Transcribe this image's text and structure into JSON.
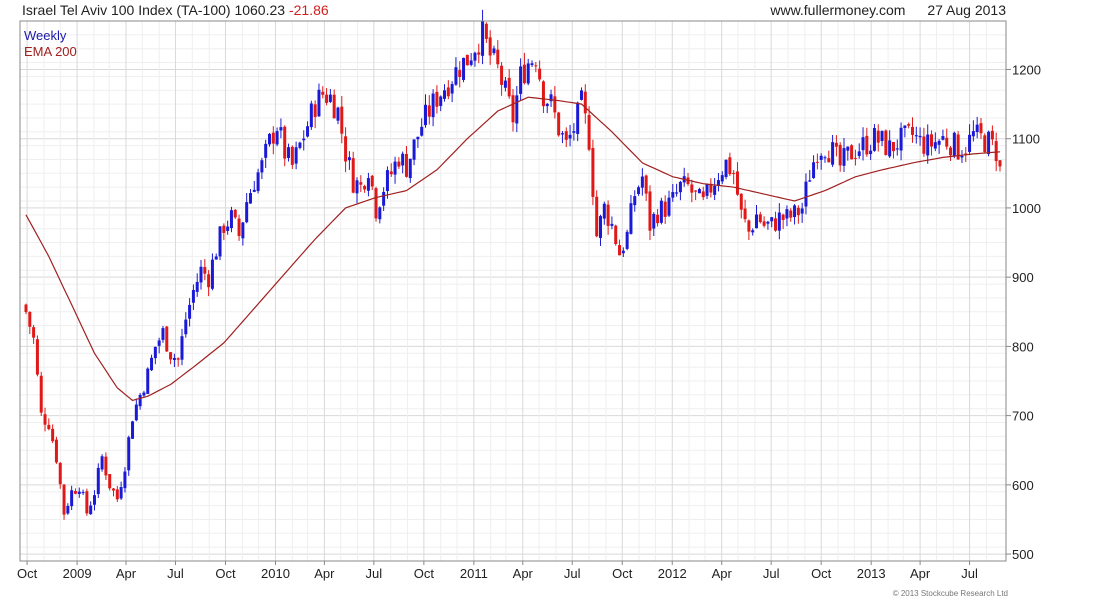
{
  "header": {
    "index_name": "Israel Tel Aviv 100 Index (TA-100)",
    "last_value": "1060.23",
    "change": "-21.86",
    "site": "www.fullermoney.com",
    "date": "27 Aug 2013"
  },
  "legend": {
    "series1": "Weekly",
    "series2": "EMA 200"
  },
  "copyright": "© 2013 Stockcube Research Ltd",
  "colors": {
    "up": "#1a1ad6",
    "down": "#e01818",
    "ema": "#a02020",
    "grid": "#d9d9d9"
  },
  "chart_data": {
    "type": "line",
    "subtype": "candlestick",
    "title": "Israel Tel Aviv 100 Index (TA-100) 1060.23 -21.86",
    "xlabel": "",
    "ylabel": "",
    "ylim": [
      490,
      1270
    ],
    "yticks": [
      500,
      600,
      700,
      800,
      900,
      1000,
      1100,
      1200
    ],
    "xticks": [
      "Oct",
      "2009",
      "Apr",
      "Jul",
      "Oct",
      "2010",
      "Apr",
      "Jul",
      "Oct",
      "2011",
      "Apr",
      "Jul",
      "Oct",
      "2012",
      "Apr",
      "Jul",
      "Oct",
      "2013",
      "Apr",
      "Jul"
    ],
    "grid": true,
    "axis_side": "right",
    "x_start": "2008-09-29",
    "x_end": "2013-08-26",
    "weekly_anchor_prices": [
      [
        "2008-09-29",
        850
      ],
      [
        "2008-10-13",
        810
      ],
      [
        "2008-10-27",
        700
      ],
      [
        "2008-11-10",
        690
      ],
      [
        "2008-11-24",
        640
      ],
      [
        "2008-12-08",
        560
      ],
      [
        "2008-12-22",
        590
      ],
      [
        "2009-01-05",
        600
      ],
      [
        "2009-01-19",
        560
      ],
      [
        "2009-02-02",
        590
      ],
      [
        "2009-02-16",
        640
      ],
      [
        "2009-03-02",
        600
      ],
      [
        "2009-03-16",
        580
      ],
      [
        "2009-03-30",
        630
      ],
      [
        "2009-04-13",
        700
      ],
      [
        "2009-04-27",
        730
      ],
      [
        "2009-05-11",
        760
      ],
      [
        "2009-05-25",
        800
      ],
      [
        "2009-06-08",
        820
      ],
      [
        "2009-06-22",
        790
      ],
      [
        "2009-07-06",
        780
      ],
      [
        "2009-07-20",
        840
      ],
      [
        "2009-08-03",
        880
      ],
      [
        "2009-08-17",
        910
      ],
      [
        "2009-08-31",
        900
      ],
      [
        "2009-09-14",
        940
      ],
      [
        "2009-09-28",
        975
      ],
      [
        "2009-10-12",
        985
      ],
      [
        "2009-10-26",
        960
      ],
      [
        "2009-11-09",
        1010
      ],
      [
        "2009-11-23",
        1040
      ],
      [
        "2009-12-07",
        1060
      ],
      [
        "2009-12-21",
        1095
      ],
      [
        "2010-01-04",
        1120
      ],
      [
        "2010-01-18",
        1080
      ],
      [
        "2010-02-01",
        1060
      ],
      [
        "2010-02-15",
        1090
      ],
      [
        "2010-03-01",
        1120
      ],
      [
        "2010-03-15",
        1150
      ],
      [
        "2010-03-29",
        1165
      ],
      [
        "2010-04-12",
        1160
      ],
      [
        "2010-04-26",
        1140
      ],
      [
        "2010-05-10",
        1080
      ],
      [
        "2010-05-24",
        1040
      ],
      [
        "2010-06-07",
        1030
      ],
      [
        "2010-06-21",
        1060
      ],
      [
        "2010-07-05",
        1000
      ],
      [
        "2010-07-19",
        1030
      ],
      [
        "2010-08-02",
        1050
      ],
      [
        "2010-08-16",
        1075
      ],
      [
        "2010-08-30",
        1060
      ],
      [
        "2010-09-13",
        1090
      ],
      [
        "2010-09-27",
        1120
      ],
      [
        "2010-10-11",
        1140
      ],
      [
        "2010-10-25",
        1160
      ],
      [
        "2010-11-08",
        1175
      ],
      [
        "2010-11-22",
        1190
      ],
      [
        "2010-12-06",
        1205
      ],
      [
        "2010-12-20",
        1215
      ],
      [
        "2011-01-03",
        1235
      ],
      [
        "2011-01-17",
        1250
      ],
      [
        "2011-01-31",
        1220
      ],
      [
        "2011-02-14",
        1200
      ],
      [
        "2011-02-28",
        1165
      ],
      [
        "2011-03-14",
        1130
      ],
      [
        "2011-03-28",
        1190
      ],
      [
        "2011-04-11",
        1210
      ],
      [
        "2011-04-25",
        1220
      ],
      [
        "2011-05-09",
        1165
      ],
      [
        "2011-05-23",
        1150
      ],
      [
        "2011-06-06",
        1115
      ],
      [
        "2011-06-20",
        1090
      ],
      [
        "2011-07-04",
        1115
      ],
      [
        "2011-07-18",
        1150
      ],
      [
        "2011-08-01",
        1100
      ],
      [
        "2011-08-15",
        960
      ],
      [
        "2011-08-29",
        1000
      ],
      [
        "2011-09-12",
        975
      ],
      [
        "2011-09-26",
        935
      ],
      [
        "2011-10-10",
        960
      ],
      [
        "2011-10-24",
        1020
      ],
      [
        "2011-11-07",
        1045
      ],
      [
        "2011-11-21",
        975
      ],
      [
        "2011-12-05",
        995
      ],
      [
        "2011-12-19",
        1000
      ],
      [
        "2012-01-02",
        1010
      ],
      [
        "2012-01-16",
        1030
      ],
      [
        "2012-01-30",
        1030
      ],
      [
        "2012-02-13",
        1015
      ],
      [
        "2012-02-27",
        1005
      ],
      [
        "2012-03-12",
        1030
      ],
      [
        "2012-03-26",
        1050
      ],
      [
        "2012-04-09",
        1065
      ],
      [
        "2012-04-23",
        1050
      ],
      [
        "2012-05-07",
        990
      ],
      [
        "2012-05-21",
        965
      ],
      [
        "2012-06-04",
        990
      ],
      [
        "2012-06-18",
        975
      ],
      [
        "2012-07-02",
        975
      ],
      [
        "2012-07-16",
        985
      ],
      [
        "2012-07-30",
        985
      ],
      [
        "2012-08-13",
        990
      ],
      [
        "2012-08-27",
        1000
      ],
      [
        "2012-09-10",
        1050
      ],
      [
        "2012-09-24",
        1085
      ],
      [
        "2012-10-08",
        1090
      ],
      [
        "2012-10-22",
        1080
      ],
      [
        "2012-11-05",
        1060
      ],
      [
        "2012-11-19",
        1075
      ],
      [
        "2012-12-03",
        1085
      ],
      [
        "2012-12-17",
        1090
      ],
      [
        "2013-01-07",
        1100
      ],
      [
        "2013-01-21",
        1095
      ],
      [
        "2013-02-04",
        1085
      ],
      [
        "2013-02-18",
        1095
      ],
      [
        "2013-03-04",
        1100
      ],
      [
        "2013-03-18",
        1105
      ],
      [
        "2013-04-01",
        1095
      ],
      [
        "2013-04-15",
        1090
      ],
      [
        "2013-04-29",
        1095
      ],
      [
        "2013-05-13",
        1100
      ],
      [
        "2013-05-27",
        1095
      ],
      [
        "2013-06-10",
        1085
      ],
      [
        "2013-06-24",
        1090
      ],
      [
        "2013-07-08",
        1105
      ],
      [
        "2013-07-22",
        1100
      ],
      [
        "2013-08-05",
        1095
      ],
      [
        "2013-08-19",
        1082
      ],
      [
        "2013-08-26",
        1060
      ]
    ],
    "ema_anchor_values": [
      [
        "2008-09-29",
        990
      ],
      [
        "2008-11-10",
        930
      ],
      [
        "2008-12-22",
        860
      ],
      [
        "2009-02-02",
        790
      ],
      [
        "2009-03-16",
        740
      ],
      [
        "2009-04-13",
        722
      ],
      [
        "2009-05-11",
        728
      ],
      [
        "2009-06-22",
        745
      ],
      [
        "2009-08-03",
        770
      ],
      [
        "2009-09-28",
        805
      ],
      [
        "2009-11-23",
        855
      ],
      [
        "2010-01-18",
        905
      ],
      [
        "2010-03-15",
        955
      ],
      [
        "2010-05-10",
        1000
      ],
      [
        "2010-07-05",
        1015
      ],
      [
        "2010-08-30",
        1025
      ],
      [
        "2010-10-25",
        1055
      ],
      [
        "2010-12-20",
        1100
      ],
      [
        "2011-02-14",
        1140
      ],
      [
        "2011-04-11",
        1160
      ],
      [
        "2011-06-06",
        1155
      ],
      [
        "2011-07-18",
        1150
      ],
      [
        "2011-09-12",
        1110
      ],
      [
        "2011-11-07",
        1065
      ],
      [
        "2012-01-02",
        1045
      ],
      [
        "2012-02-27",
        1035
      ],
      [
        "2012-04-23",
        1030
      ],
      [
        "2012-06-18",
        1020
      ],
      [
        "2012-08-13",
        1010
      ],
      [
        "2012-10-08",
        1025
      ],
      [
        "2012-12-03",
        1045
      ],
      [
        "2013-01-21",
        1055
      ],
      [
        "2013-03-18",
        1065
      ],
      [
        "2013-05-13",
        1073
      ],
      [
        "2013-07-08",
        1078
      ],
      [
        "2013-08-26",
        1081
      ]
    ]
  }
}
